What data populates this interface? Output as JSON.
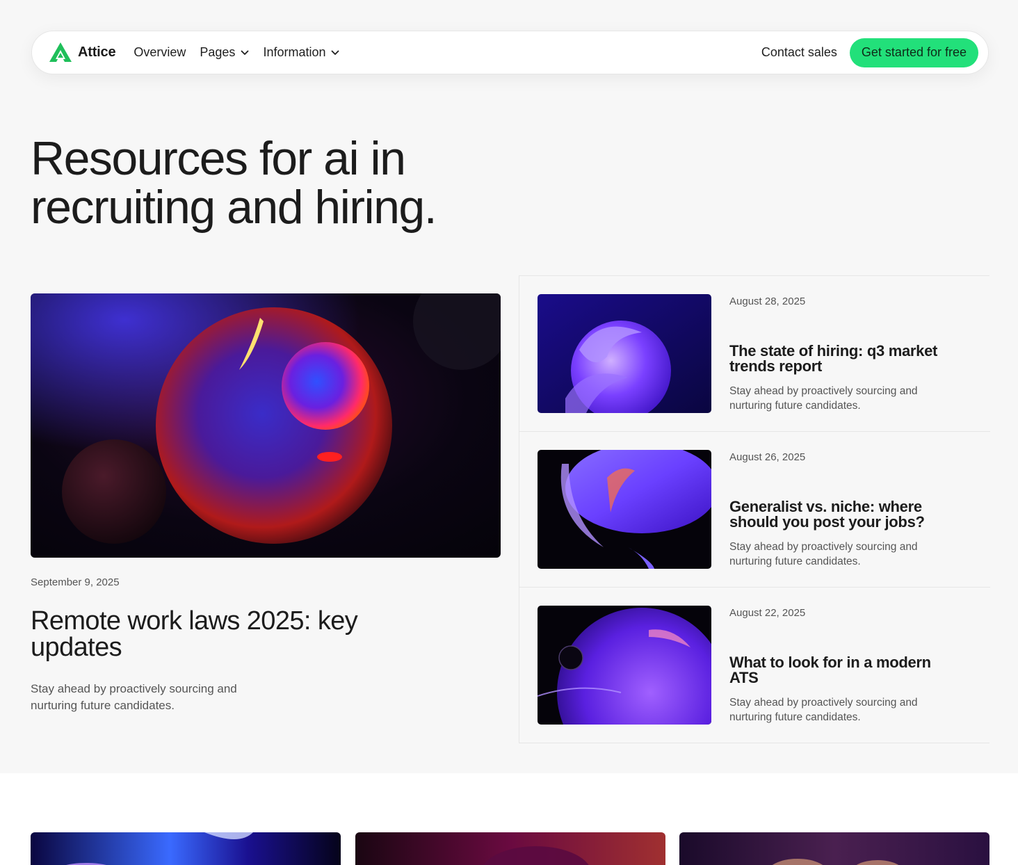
{
  "nav": {
    "brand": "Attice",
    "links": [
      {
        "label": "Overview",
        "has_dropdown": false
      },
      {
        "label": "Pages",
        "has_dropdown": true
      },
      {
        "label": "Information",
        "has_dropdown": true
      }
    ],
    "contact_label": "Contact sales",
    "cta_label": "Get started for free",
    "accent_color": "#22e07a"
  },
  "hero": {
    "title": "Resources for ai in recruiting and hiring."
  },
  "featured": {
    "date": "September 9, 2025",
    "title": "Remote work laws 2025: key updates",
    "description": "Stay ahead by proactively sourcing and nurturing future candidates."
  },
  "articles": [
    {
      "date": "August 28, 2025",
      "title": "The state of hiring: q3 market trends report",
      "description": "Stay ahead by proactively sourcing and nurturing future candidates."
    },
    {
      "date": "August 26, 2025",
      "title": "Generalist vs. niche: where should you post your jobs?",
      "description": "Stay ahead by proactively sourcing and nurturing future candidates."
    },
    {
      "date": "August 22, 2025",
      "title": "What to look for in a modern ATS",
      "description": "Stay ahead by proactively sourcing and nurturing future candidates."
    }
  ]
}
